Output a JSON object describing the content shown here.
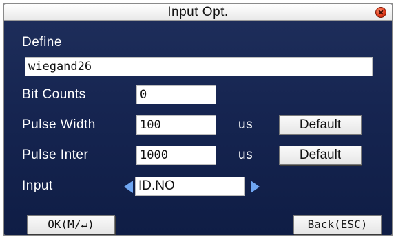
{
  "window": {
    "title": "Input Opt."
  },
  "define": {
    "label": "Define",
    "value": "wiegand26"
  },
  "bit_counts": {
    "label": "Bit Counts",
    "value": "0"
  },
  "pulse_width": {
    "label": "Pulse Width",
    "value": "100",
    "unit": "us",
    "default_label": "Default"
  },
  "pulse_inter": {
    "label": "Pulse Inter",
    "value": "1000",
    "unit": "us",
    "default_label": "Default"
  },
  "input": {
    "label": "Input",
    "value": "ID.NO"
  },
  "footer": {
    "ok_label": "OK(M/↵)",
    "back_label": "Back(ESC)"
  },
  "icons": {
    "close": "close-icon",
    "prev": "arrow-left-icon",
    "next": "arrow-right-icon"
  },
  "colors": {
    "background": "#162551",
    "arrow": "#6fa6f2",
    "close": "#e23b1b"
  }
}
